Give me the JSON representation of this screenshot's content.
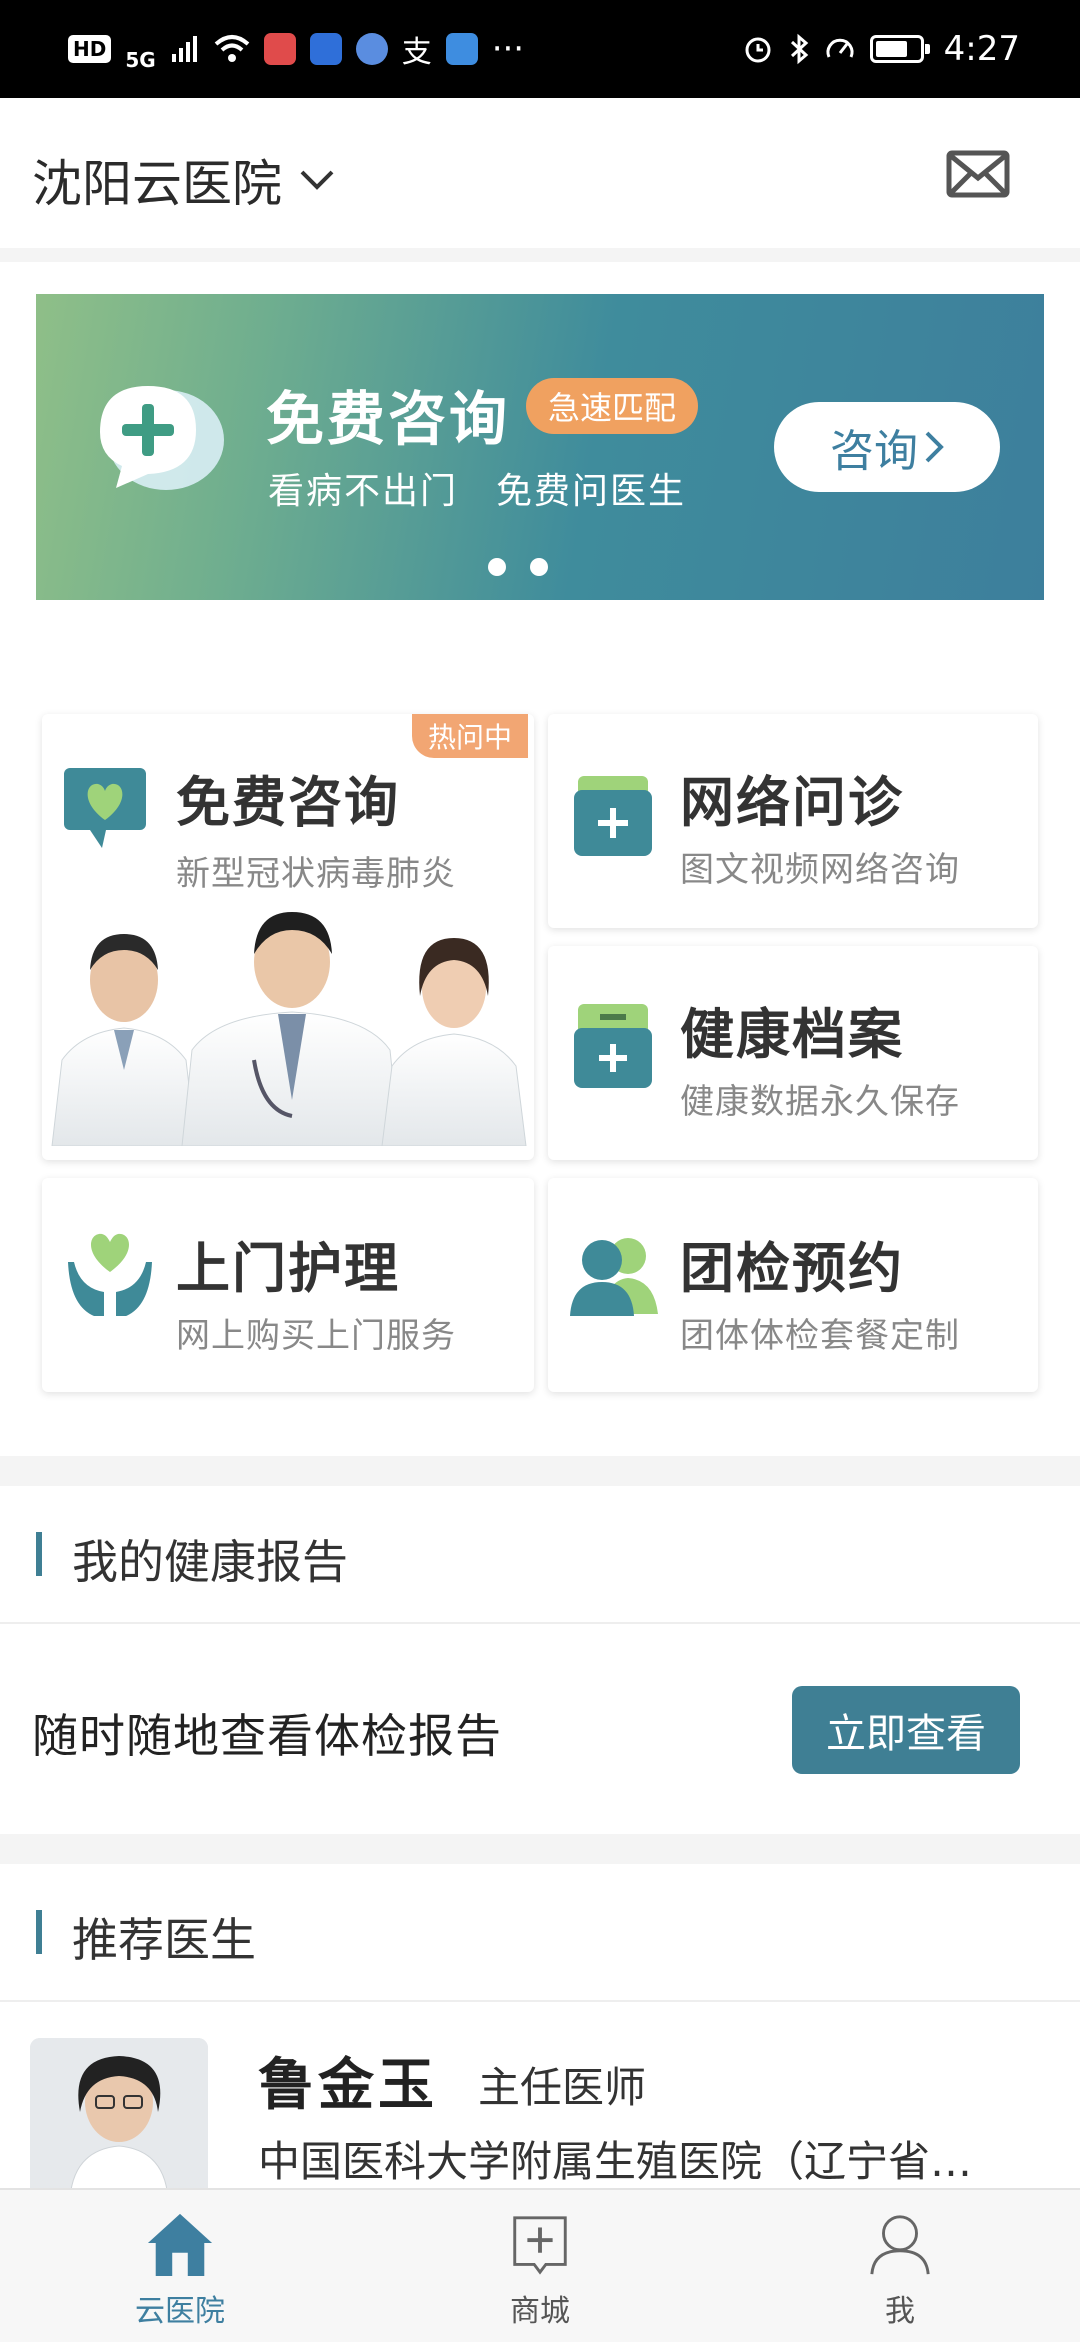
{
  "status_bar": {
    "hd": "HD",
    "network": "5G",
    "more": "···",
    "time": "4:27"
  },
  "header": {
    "city": "沈阳云医院",
    "icons": {
      "dropdown": "chevron-down-icon",
      "mail": "mail-icon"
    }
  },
  "banner": {
    "title": "免费咨询",
    "badge": "急速匹配",
    "subtitle": "看病不出门　免费问医生",
    "button": "咨询",
    "page_count": 2,
    "colors": {
      "start": "#8fbf88",
      "end": "#3d7f9c",
      "badge": "#f0a160"
    }
  },
  "services": [
    {
      "title": "免费咨询",
      "subtitle": "新型冠状病毒肺炎",
      "tag": "热问中",
      "icon": "heart-chat-icon"
    },
    {
      "title": "网络问诊",
      "subtitle": "图文视频网络咨询",
      "icon": "medical-card-icon"
    },
    {
      "title": "健康档案",
      "subtitle": "健康数据永久保存",
      "icon": "health-folder-icon"
    },
    {
      "title": "上门护理",
      "subtitle": "网上购买上门服务",
      "icon": "hands-heart-icon"
    },
    {
      "title": "团检预约",
      "subtitle": "团体体检套餐定制",
      "icon": "group-people-icon"
    }
  ],
  "health_report": {
    "section_title": "我的健康报告",
    "text": "随时随地查看体检报告",
    "button": "立即查看"
  },
  "recommended": {
    "section_title": "推荐医生",
    "doctors": [
      {
        "name": "鲁金玉",
        "title": "主任医师",
        "hospital": "中国医科大学附属生殖医院（辽宁省…"
      }
    ]
  },
  "bottom_nav": [
    {
      "label": "云医院",
      "icon": "home-icon",
      "active": true
    },
    {
      "label": "商城",
      "icon": "shop-icon",
      "active": false
    },
    {
      "label": "我",
      "icon": "user-icon",
      "active": false
    }
  ],
  "colors": {
    "accent": "#3f7f94",
    "active_nav": "#3e7fa0",
    "inactive_nav": "#555555"
  }
}
